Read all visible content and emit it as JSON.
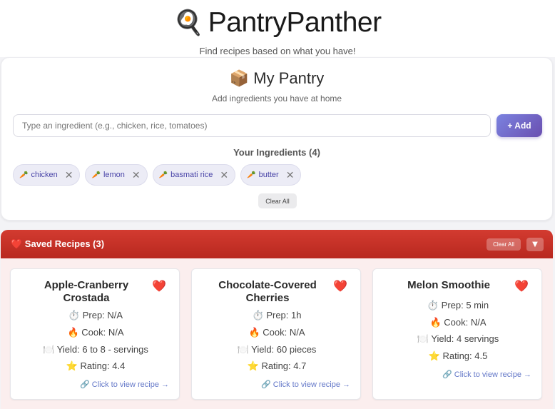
{
  "app": {
    "icon": "🍳",
    "title": "PantryPanther",
    "tagline": "Find recipes based on what you have!"
  },
  "pantry": {
    "icon": "📦",
    "title": "My Pantry",
    "subtitle": "Add ingredients you have at home",
    "input_placeholder": "Type an ingredient (e.g., chicken, rice, tomatoes)",
    "add_label": "+ Add",
    "ingredients_heading": "Your Ingredients (4)",
    "chip_icon": "🥕",
    "remove_glyph": "✕",
    "ingredients": [
      "chicken",
      "lemon",
      "basmati rice",
      "butter"
    ],
    "clear_all_label": "Clear All"
  },
  "saved": {
    "title": "❤️ Saved Recipes (3)",
    "clear_all_label": "Clear All",
    "toggle_glyph": "▼",
    "heart_glyph": "❤️",
    "link_icon": "🔗",
    "link_label": "Click to view recipe →",
    "recipes": [
      {
        "name": "Apple-Cranberry Crostada",
        "prep": "⏱️ Prep: N/A",
        "cook": "🔥 Cook: N/A",
        "yield": "🍽️ Yield: 6 to 8 - servings",
        "rating": "⭐ Rating: 4.4"
      },
      {
        "name": "Chocolate-Covered Cherries",
        "prep": "⏱️ Prep: 1h",
        "cook": "🔥 Cook: N/A",
        "yield": "🍽️ Yield: 60 pieces",
        "rating": "⭐ Rating: 4.7"
      },
      {
        "name": "Melon Smoothie",
        "prep": "⏱️ Prep: 5 min",
        "cook": "🔥 Cook: N/A",
        "yield": "🍽️ Yield: 4 servings",
        "rating": "⭐ Rating: 4.5"
      }
    ]
  },
  "colors": {
    "accent": "#6a4fb0",
    "saved_bar": "#c8322a",
    "chip_text": "#4a45a8",
    "link": "#6478c8"
  }
}
